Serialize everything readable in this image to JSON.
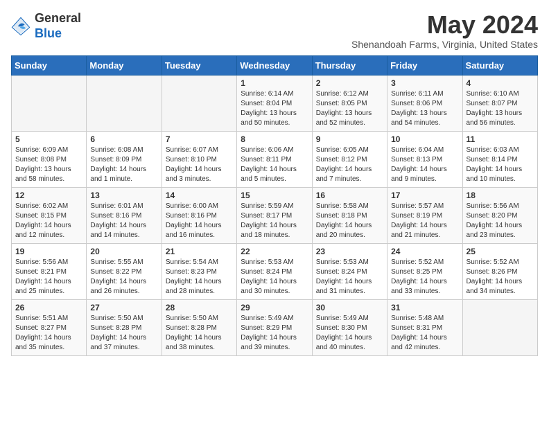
{
  "header": {
    "logo_general": "General",
    "logo_blue": "Blue",
    "month_year": "May 2024",
    "location": "Shenandoah Farms, Virginia, United States"
  },
  "calendar": {
    "days_of_week": [
      "Sunday",
      "Monday",
      "Tuesday",
      "Wednesday",
      "Thursday",
      "Friday",
      "Saturday"
    ],
    "weeks": [
      [
        {
          "day": "",
          "content": ""
        },
        {
          "day": "",
          "content": ""
        },
        {
          "day": "",
          "content": ""
        },
        {
          "day": "1",
          "content": "Sunrise: 6:14 AM\nSunset: 8:04 PM\nDaylight: 13 hours\nand 50 minutes."
        },
        {
          "day": "2",
          "content": "Sunrise: 6:12 AM\nSunset: 8:05 PM\nDaylight: 13 hours\nand 52 minutes."
        },
        {
          "day": "3",
          "content": "Sunrise: 6:11 AM\nSunset: 8:06 PM\nDaylight: 13 hours\nand 54 minutes."
        },
        {
          "day": "4",
          "content": "Sunrise: 6:10 AM\nSunset: 8:07 PM\nDaylight: 13 hours\nand 56 minutes."
        }
      ],
      [
        {
          "day": "5",
          "content": "Sunrise: 6:09 AM\nSunset: 8:08 PM\nDaylight: 13 hours\nand 58 minutes."
        },
        {
          "day": "6",
          "content": "Sunrise: 6:08 AM\nSunset: 8:09 PM\nDaylight: 14 hours\nand 1 minute."
        },
        {
          "day": "7",
          "content": "Sunrise: 6:07 AM\nSunset: 8:10 PM\nDaylight: 14 hours\nand 3 minutes."
        },
        {
          "day": "8",
          "content": "Sunrise: 6:06 AM\nSunset: 8:11 PM\nDaylight: 14 hours\nand 5 minutes."
        },
        {
          "day": "9",
          "content": "Sunrise: 6:05 AM\nSunset: 8:12 PM\nDaylight: 14 hours\nand 7 minutes."
        },
        {
          "day": "10",
          "content": "Sunrise: 6:04 AM\nSunset: 8:13 PM\nDaylight: 14 hours\nand 9 minutes."
        },
        {
          "day": "11",
          "content": "Sunrise: 6:03 AM\nSunset: 8:14 PM\nDaylight: 14 hours\nand 10 minutes."
        }
      ],
      [
        {
          "day": "12",
          "content": "Sunrise: 6:02 AM\nSunset: 8:15 PM\nDaylight: 14 hours\nand 12 minutes."
        },
        {
          "day": "13",
          "content": "Sunrise: 6:01 AM\nSunset: 8:16 PM\nDaylight: 14 hours\nand 14 minutes."
        },
        {
          "day": "14",
          "content": "Sunrise: 6:00 AM\nSunset: 8:16 PM\nDaylight: 14 hours\nand 16 minutes."
        },
        {
          "day": "15",
          "content": "Sunrise: 5:59 AM\nSunset: 8:17 PM\nDaylight: 14 hours\nand 18 minutes."
        },
        {
          "day": "16",
          "content": "Sunrise: 5:58 AM\nSunset: 8:18 PM\nDaylight: 14 hours\nand 20 minutes."
        },
        {
          "day": "17",
          "content": "Sunrise: 5:57 AM\nSunset: 8:19 PM\nDaylight: 14 hours\nand 21 minutes."
        },
        {
          "day": "18",
          "content": "Sunrise: 5:56 AM\nSunset: 8:20 PM\nDaylight: 14 hours\nand 23 minutes."
        }
      ],
      [
        {
          "day": "19",
          "content": "Sunrise: 5:56 AM\nSunset: 8:21 PM\nDaylight: 14 hours\nand 25 minutes."
        },
        {
          "day": "20",
          "content": "Sunrise: 5:55 AM\nSunset: 8:22 PM\nDaylight: 14 hours\nand 26 minutes."
        },
        {
          "day": "21",
          "content": "Sunrise: 5:54 AM\nSunset: 8:23 PM\nDaylight: 14 hours\nand 28 minutes."
        },
        {
          "day": "22",
          "content": "Sunrise: 5:53 AM\nSunset: 8:24 PM\nDaylight: 14 hours\nand 30 minutes."
        },
        {
          "day": "23",
          "content": "Sunrise: 5:53 AM\nSunset: 8:24 PM\nDaylight: 14 hours\nand 31 minutes."
        },
        {
          "day": "24",
          "content": "Sunrise: 5:52 AM\nSunset: 8:25 PM\nDaylight: 14 hours\nand 33 minutes."
        },
        {
          "day": "25",
          "content": "Sunrise: 5:52 AM\nSunset: 8:26 PM\nDaylight: 14 hours\nand 34 minutes."
        }
      ],
      [
        {
          "day": "26",
          "content": "Sunrise: 5:51 AM\nSunset: 8:27 PM\nDaylight: 14 hours\nand 35 minutes."
        },
        {
          "day": "27",
          "content": "Sunrise: 5:50 AM\nSunset: 8:28 PM\nDaylight: 14 hours\nand 37 minutes."
        },
        {
          "day": "28",
          "content": "Sunrise: 5:50 AM\nSunset: 8:28 PM\nDaylight: 14 hours\nand 38 minutes."
        },
        {
          "day": "29",
          "content": "Sunrise: 5:49 AM\nSunset: 8:29 PM\nDaylight: 14 hours\nand 39 minutes."
        },
        {
          "day": "30",
          "content": "Sunrise: 5:49 AM\nSunset: 8:30 PM\nDaylight: 14 hours\nand 40 minutes."
        },
        {
          "day": "31",
          "content": "Sunrise: 5:48 AM\nSunset: 8:31 PM\nDaylight: 14 hours\nand 42 minutes."
        },
        {
          "day": "",
          "content": ""
        }
      ]
    ]
  }
}
